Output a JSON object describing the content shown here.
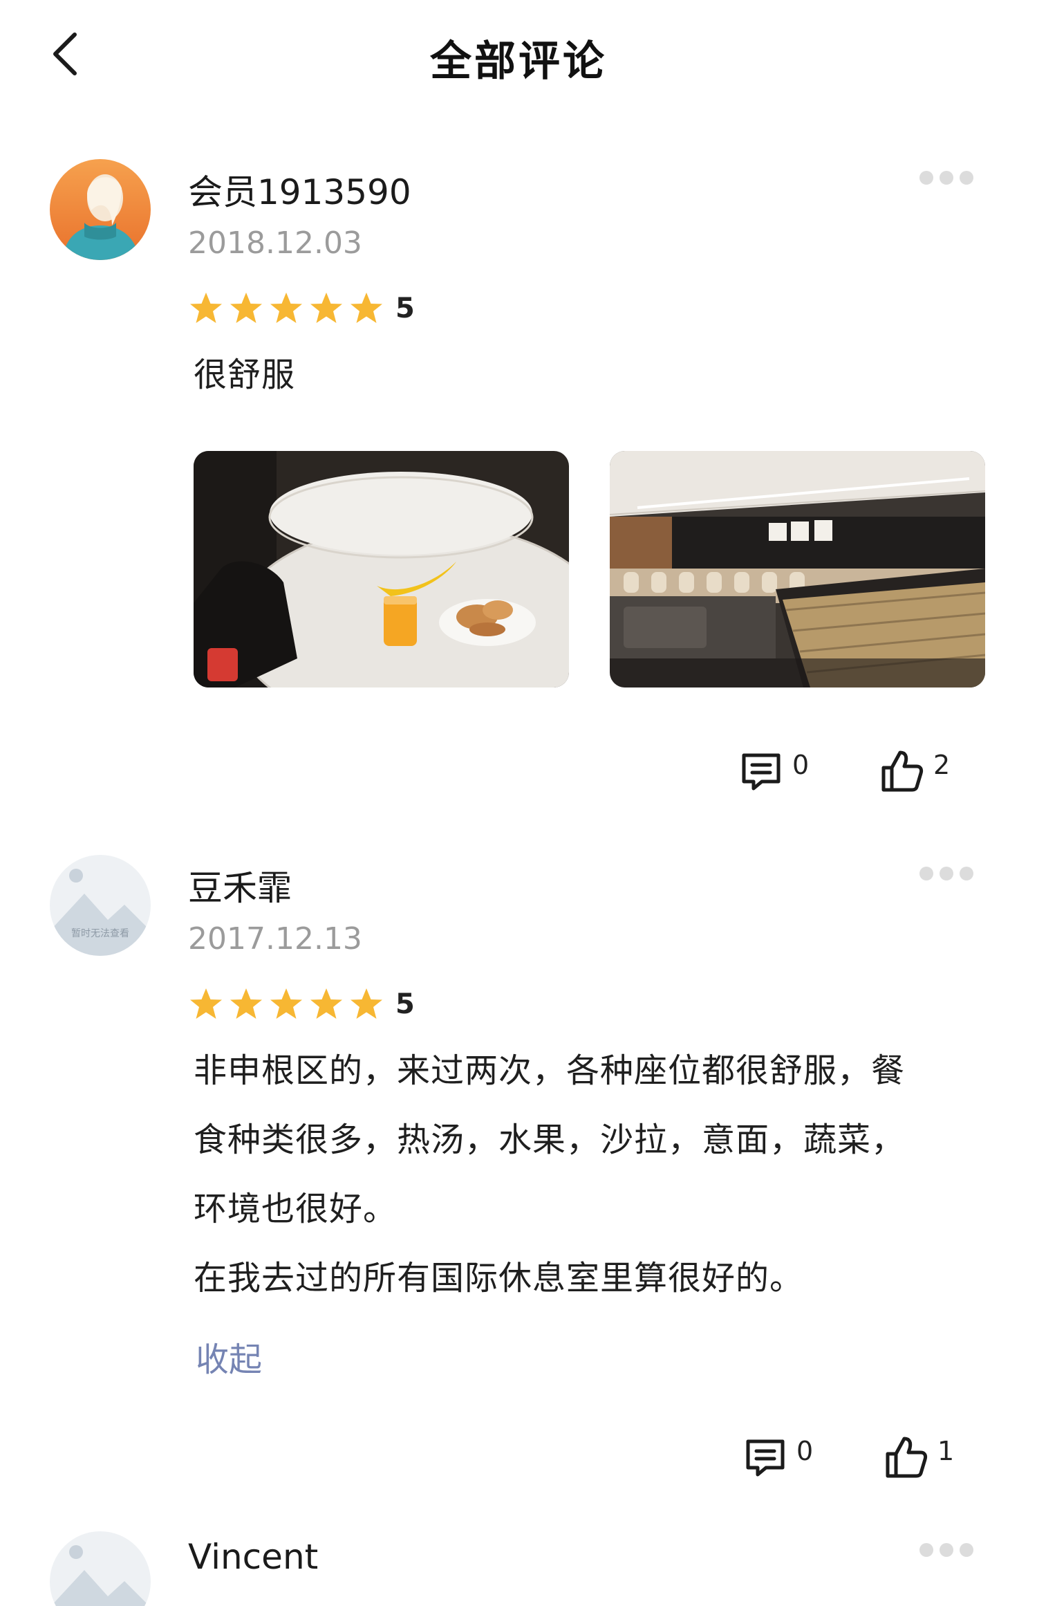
{
  "header": {
    "title": "全部评论",
    "back_icon": "chevron-left-icon"
  },
  "colors": {
    "star": "#f7b733",
    "link": "#7584b3",
    "date": "#9b9b9b",
    "text": "#1f1f1f"
  },
  "reviews": [
    {
      "username": "会员1913590",
      "date": "2018.12.03",
      "stars": 5,
      "score": "5",
      "paragraphs": [
        "很舒服"
      ],
      "photos": [
        "food-photo",
        "lounge-photo"
      ],
      "comments": "0",
      "likes": "2"
    },
    {
      "username": "豆禾霏",
      "date": "2017.12.13",
      "avatar_text": "暂时无法查看",
      "stars": 5,
      "score": "5",
      "paragraphs": [
        "非申根区的，来过两次，各种座位都很舒服，餐",
        "食种类很多，热汤，水果，沙拉，意面，蔬菜，",
        "环境也很好。",
        "在我去过的所有国际休息室里算很好的。"
      ],
      "collapse_label": "收起",
      "comments": "0",
      "likes": "1"
    },
    {
      "username": "Vincent"
    }
  ]
}
